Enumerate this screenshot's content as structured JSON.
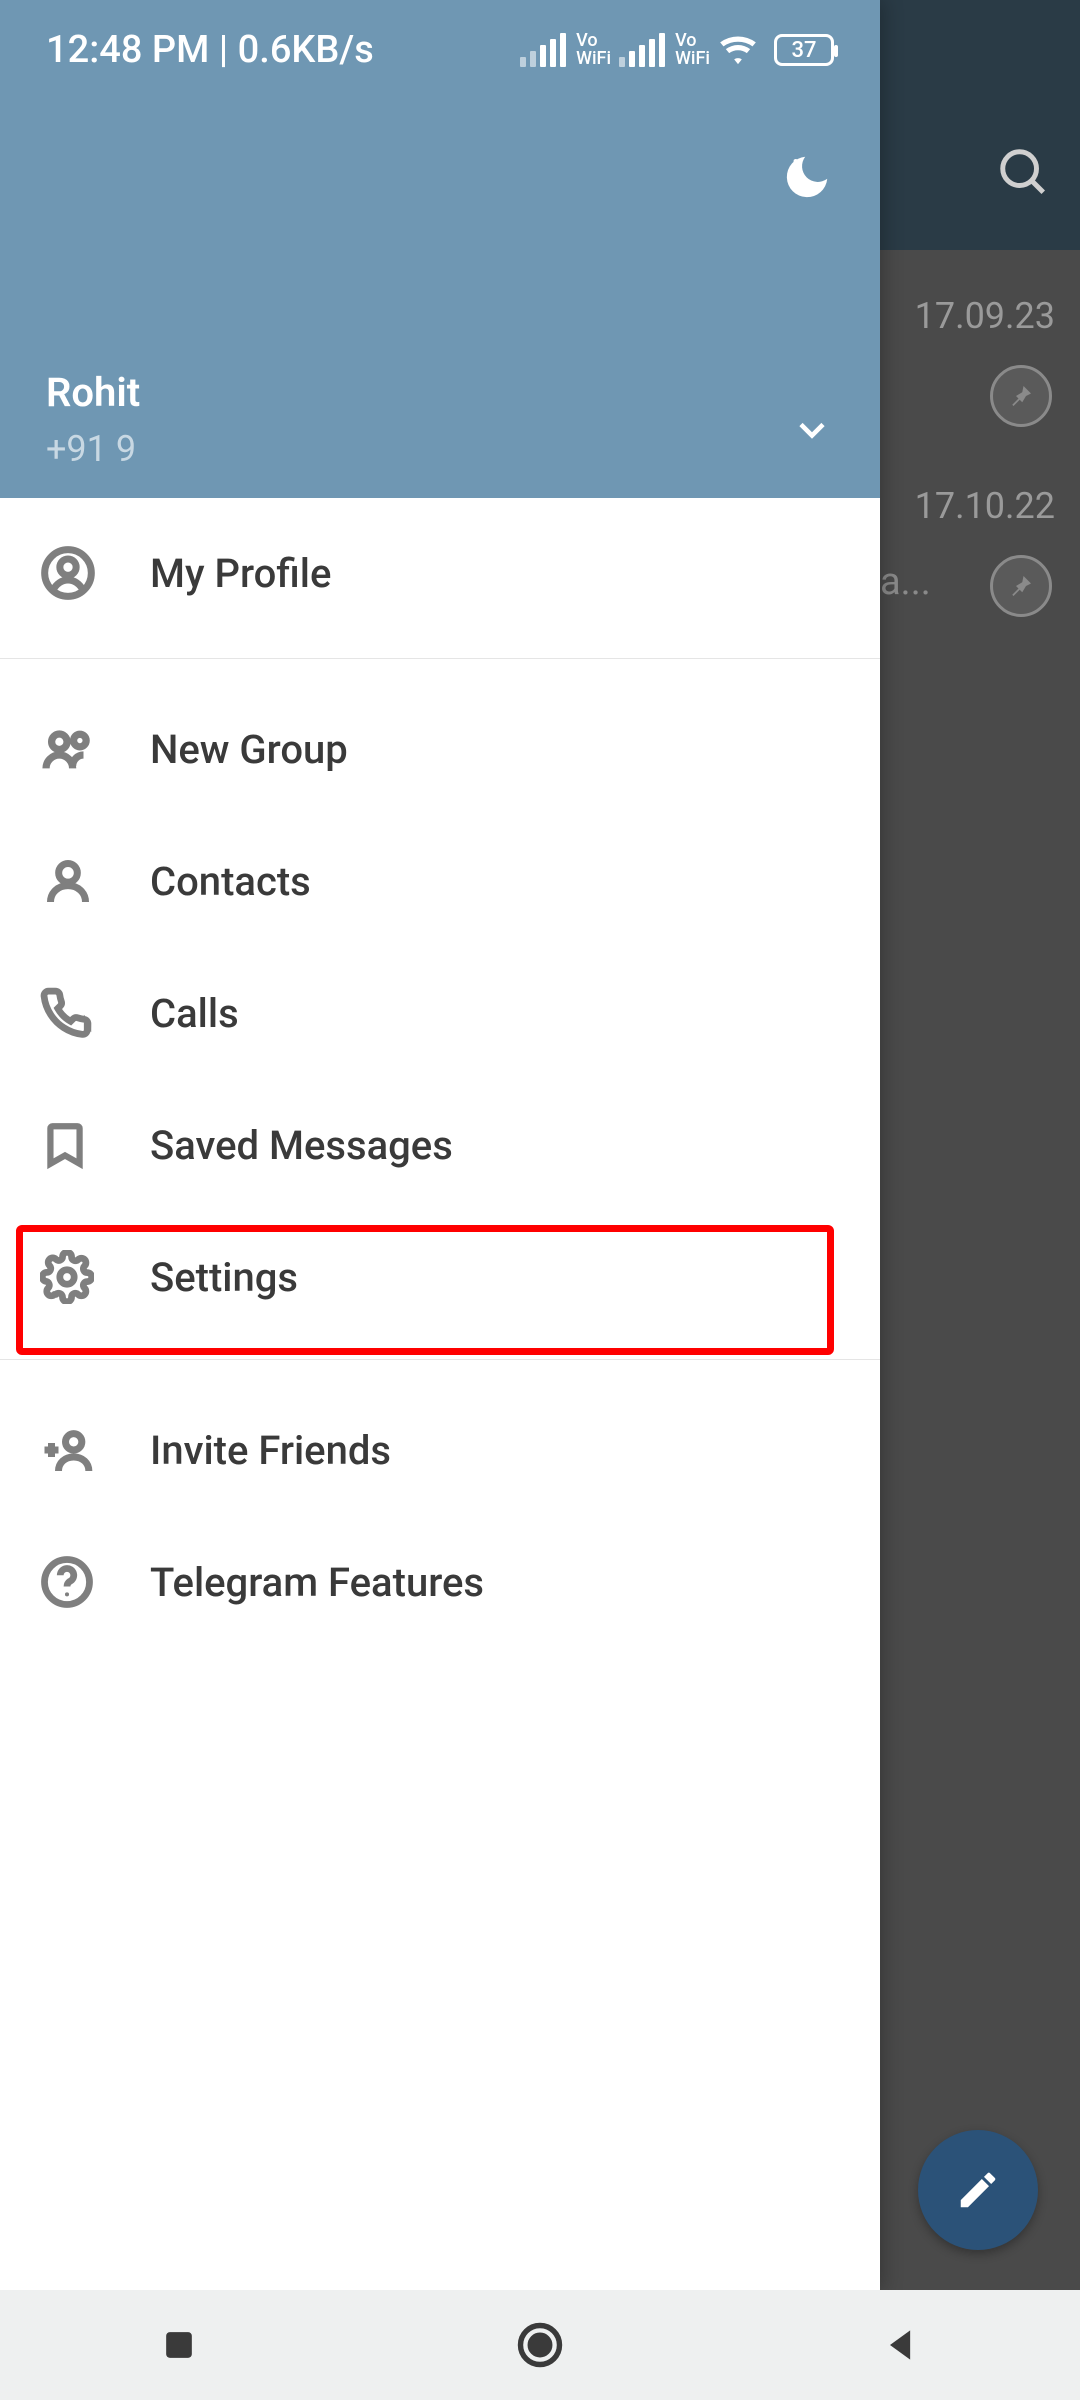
{
  "statusbar": {
    "time": "12:48 PM | 0.6KB/s",
    "battery": "37"
  },
  "drawer": {
    "user_name": "Rohit",
    "user_phone": "+91 9",
    "menu": {
      "my_profile": "My Profile",
      "new_group": "New Group",
      "contacts": "Contacts",
      "calls": "Calls",
      "saved_messages": "Saved Messages",
      "settings": "Settings",
      "invite_friends": "Invite Friends",
      "telegram_features": "Telegram Features"
    }
  },
  "chats": [
    {
      "date": "17.09.23",
      "snippet": ""
    },
    {
      "date": "17.10.22",
      "snippet": "a..."
    }
  ]
}
